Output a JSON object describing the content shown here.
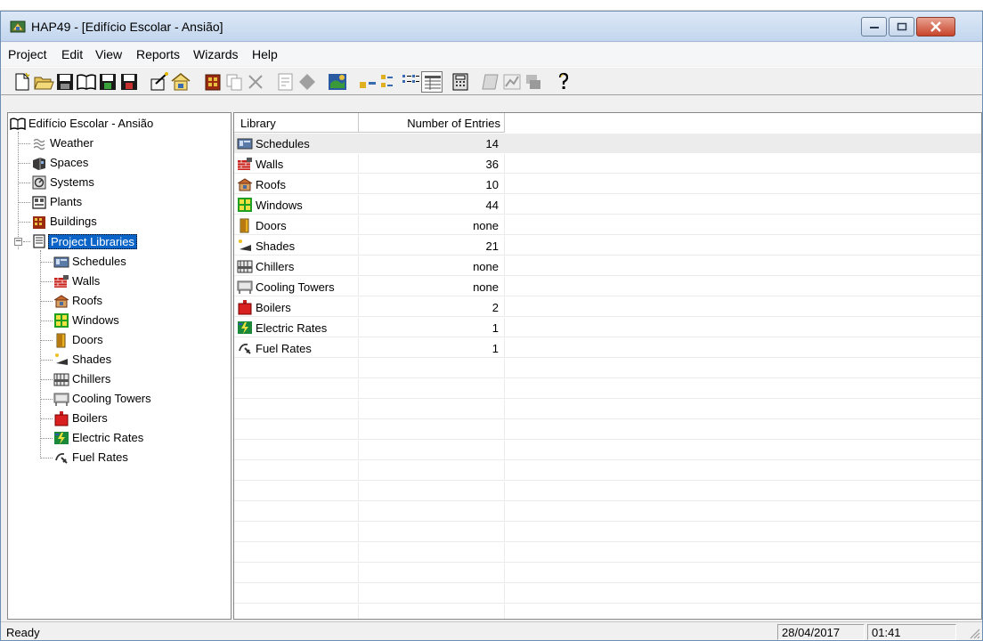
{
  "window": {
    "title": "HAP49 - [Edifício Escolar - Ansião]"
  },
  "menu": [
    "Project",
    "Edit",
    "View",
    "Reports",
    "Wizards",
    "Help"
  ],
  "toolbar_icons": [
    "new-project-icon",
    "open-project-icon",
    "save-icon",
    "library-book-icon",
    "archive-icon",
    "retrieve-icon",
    "wizard-icon",
    "home-building-icon",
    "building-icon",
    "copy-icon",
    "delete-icon",
    "properties-icon",
    "diamond-icon",
    "weather-map-icon",
    "large-icons-icon",
    "small-icons-icon",
    "list-view-icon",
    "details-view-icon",
    "calculator-icon",
    "report-view-icon",
    "chart-icon",
    "print-report-icon",
    "help-icon"
  ],
  "tree": {
    "root": "Edifício Escolar - Ansião",
    "top_items": [
      "Weather",
      "Spaces",
      "Systems",
      "Plants",
      "Buildings"
    ],
    "libraries_label": "Project Libraries",
    "library_items": [
      "Schedules",
      "Walls",
      "Roofs",
      "Windows",
      "Doors",
      "Shades",
      "Chillers",
      "Cooling Towers",
      "Boilers",
      "Electric Rates",
      "Fuel Rates"
    ]
  },
  "grid": {
    "columns": [
      "Library",
      "Number of Entries"
    ],
    "rows": [
      {
        "name": "Schedules",
        "entries": "14"
      },
      {
        "name": "Walls",
        "entries": "36"
      },
      {
        "name": "Roofs",
        "entries": "10"
      },
      {
        "name": "Windows",
        "entries": "44"
      },
      {
        "name": "Doors",
        "entries": "none"
      },
      {
        "name": "Shades",
        "entries": "21"
      },
      {
        "name": "Chillers",
        "entries": "none"
      },
      {
        "name": "Cooling Towers",
        "entries": "none"
      },
      {
        "name": "Boilers",
        "entries": "2"
      },
      {
        "name": "Electric Rates",
        "entries": "1"
      },
      {
        "name": "Fuel Rates",
        "entries": "1"
      }
    ]
  },
  "status": {
    "text": "Ready",
    "date": "28/04/2017",
    "time": "01:41"
  },
  "colors": {
    "selection": "#0a64c8",
    "title_gradient_top": "#dce8f6",
    "close_button": "#c8442b"
  }
}
